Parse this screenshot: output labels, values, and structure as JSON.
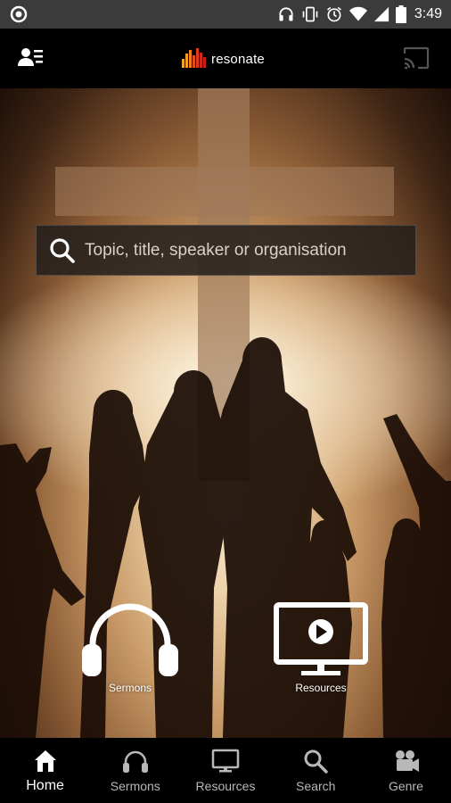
{
  "status_bar": {
    "time": "3:49",
    "icons": [
      "circle-notification-icon",
      "headphones-icon",
      "vibrate-icon",
      "alarm-icon",
      "wifi-icon",
      "signal-icon",
      "battery-icon"
    ]
  },
  "app_bar": {
    "logo_text": "resonate",
    "left_icon": "profile-menu-icon",
    "right_icon": "cast-icon",
    "logo_colors": [
      "#f5a623",
      "#e8491d",
      "#d9261c"
    ]
  },
  "search": {
    "placeholder": "Topic, title, speaker or organisation",
    "icon": "search-icon"
  },
  "tiles": [
    {
      "label": "Sermons",
      "icon": "headphones-icon"
    },
    {
      "label": "Resources",
      "icon": "monitor-play-icon"
    }
  ],
  "bottom_nav": {
    "items": [
      {
        "label": "Home",
        "icon": "home-icon",
        "active": true
      },
      {
        "label": "Sermons",
        "icon": "headphones-icon",
        "active": false
      },
      {
        "label": "Resources",
        "icon": "monitor-icon",
        "active": false
      },
      {
        "label": "Search",
        "icon": "search-icon",
        "active": false
      },
      {
        "label": "Genre",
        "icon": "video-camera-icon",
        "active": false
      }
    ]
  }
}
